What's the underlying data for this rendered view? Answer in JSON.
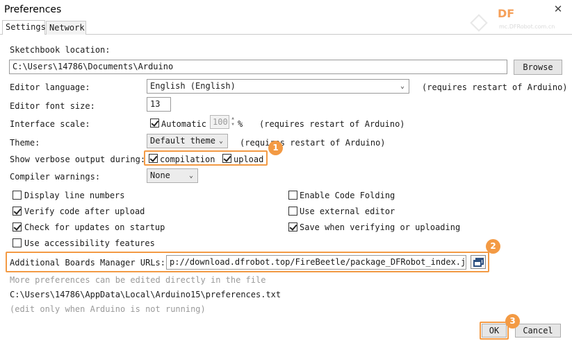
{
  "window": {
    "title": "Preferences",
    "close_glyph": "✕"
  },
  "watermark": {
    "logo": "DF",
    "url": "mc.DFRobot.com.cn"
  },
  "tabs": [
    {
      "label": "Settings",
      "active": true
    },
    {
      "label": "Network",
      "active": false
    }
  ],
  "sketchbook": {
    "label": "Sketchbook location:",
    "value": "C:\\Users\\14786\\Documents\\Arduino",
    "browse_label": "Browse"
  },
  "editor_language": {
    "label": "Editor language:",
    "value": "English (English)",
    "note": "(requires restart of Arduino)"
  },
  "font_size": {
    "label": "Editor font size:",
    "value": "13"
  },
  "interface_scale": {
    "label": "Interface scale:",
    "auto_label": "Automatic",
    "auto_checked": true,
    "value": "100",
    "unit": "%",
    "note": "(requires restart of Arduino)"
  },
  "theme": {
    "label": "Theme:",
    "value": "Default theme",
    "note": "(requires restart of Arduino)"
  },
  "verbose": {
    "label": "Show verbose output during:",
    "compilation_label": "compilation",
    "compilation_checked": true,
    "upload_label": "upload",
    "upload_checked": true
  },
  "compiler_warnings": {
    "label": "Compiler warnings:",
    "value": "None"
  },
  "checkboxes_left": [
    {
      "label": "Display line numbers",
      "checked": false
    },
    {
      "label": "Verify code after upload",
      "checked": true
    },
    {
      "label": "Check for updates on startup",
      "checked": true
    },
    {
      "label": "Use accessibility features",
      "checked": false
    }
  ],
  "checkboxes_right": [
    {
      "label": "Enable Code Folding",
      "checked": false
    },
    {
      "label": "Use external editor",
      "checked": false
    },
    {
      "label": "Save when verifying or uploading",
      "checked": true
    }
  ],
  "boards_urls": {
    "label": "Additional Boards Manager URLs:",
    "value": "p://download.dfrobot.top/FireBeetle/package_DFRobot_index.json"
  },
  "footer": {
    "more_prefs": "More preferences can be edited directly in the file",
    "prefs_path": "C:\\Users\\14786\\AppData\\Local\\Arduino15\\preferences.txt",
    "edit_note": "(edit only when Arduino is not running)"
  },
  "buttons": {
    "ok": "OK",
    "cancel": "Cancel"
  },
  "badges": [
    "1",
    "2",
    "3"
  ],
  "colors": {
    "highlight": "#f39a44",
    "muted_text": "#9a9a9a"
  }
}
